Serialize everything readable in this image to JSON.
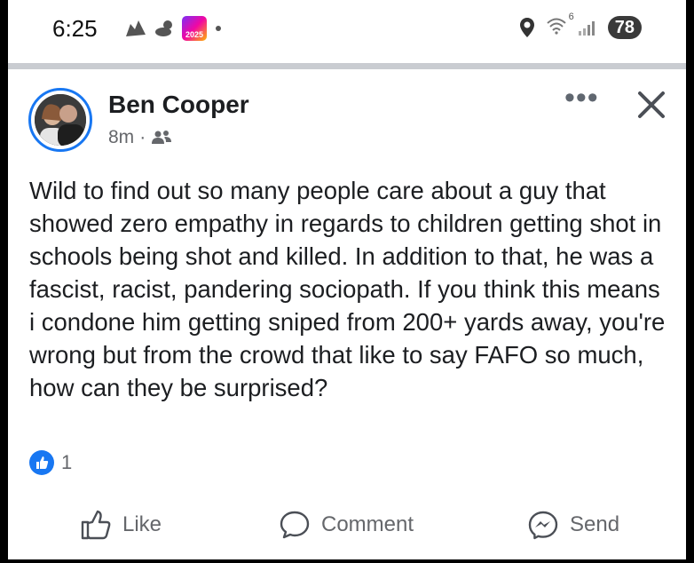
{
  "status_bar": {
    "time": "6:25",
    "app_badge_text": "2025",
    "network_label": "6",
    "battery": "78"
  },
  "post": {
    "author": "Ben Cooper",
    "timestamp": "8m",
    "separator": "·",
    "audience_icon": "friends-icon",
    "more_label": "•••",
    "text": "Wild to find out so many people care about a guy that showed zero empathy in regards to children getting shot in schools being shot and killed. In addition to that, he was a fascist, racist, pandering sociopath. If you think this means i condone him getting sniped from 200+ yards away, you're wrong but from the crowd that like to say FAFO so much, how can they be surprised?",
    "reaction_count": "1"
  },
  "actions": {
    "like": "Like",
    "comment": "Comment",
    "send": "Send"
  },
  "colors": {
    "accent": "#1877f2",
    "secondary_text": "#65676b",
    "divider": "#c9ccd1"
  }
}
